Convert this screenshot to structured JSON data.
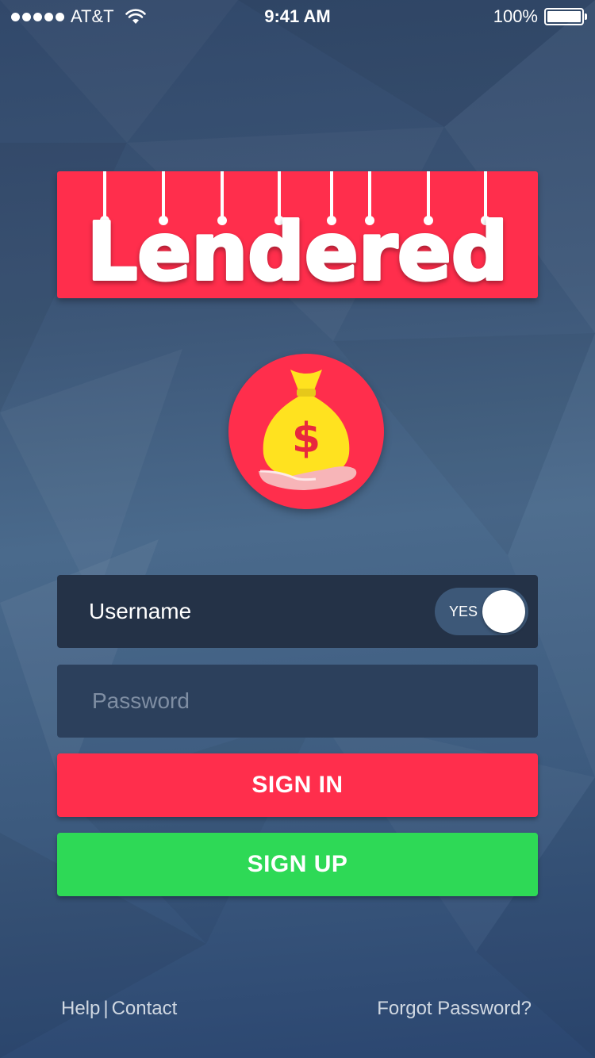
{
  "status_bar": {
    "carrier": "AT&T",
    "time": "9:41 AM",
    "battery": "100%",
    "signal_icon": "signal-dots-icon",
    "wifi_icon": "wifi-icon",
    "battery_icon": "battery-icon"
  },
  "logo": {
    "text": "Lendered",
    "icon": "money-bag-hand-icon"
  },
  "login": {
    "username_label": "Username",
    "toggle_label": "YES",
    "password_placeholder": "Password",
    "signin_label": "SIGN IN",
    "signup_label": "SIGN UP"
  },
  "footer": {
    "help": "Help",
    "separator": "|",
    "contact": "Contact",
    "forgot": "Forgot Password?"
  },
  "colors": {
    "accent_red": "#ff2e4c",
    "accent_green": "#2ed956",
    "field_dark": "#243247",
    "bag_yellow": "#ffe21f"
  }
}
